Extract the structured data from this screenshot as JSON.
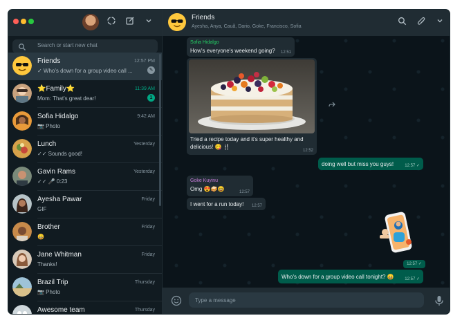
{
  "sidebar": {
    "search_placeholder": "Search or start new chat",
    "chats": [
      {
        "name": "Friends",
        "time": "12:57 PM",
        "last": "✓ Who's down for a group video call ...",
        "active": true,
        "time_green": false
      },
      {
        "name": "⭐Family⭐",
        "time": "11:39 AM",
        "last": "Mom: That's great dear!",
        "badge": "1",
        "time_green": true
      },
      {
        "name": "Sofia Hidalgo",
        "time": "9:42 AM",
        "last": "📷 Photo"
      },
      {
        "name": "Lunch",
        "time": "Yesterday",
        "last": "✓✓ Sounds good!"
      },
      {
        "name": "Gavin Rams",
        "time": "Yesterday",
        "last": "✓✓ 🎤 0:23"
      },
      {
        "name": "Ayesha Pawar",
        "time": "Friday",
        "last": "GIF"
      },
      {
        "name": "Brother",
        "time": "Friday",
        "last": "😄"
      },
      {
        "name": "Jane Whitman",
        "time": "Friday",
        "last": "Thanks!"
      },
      {
        "name": "Brazil Trip",
        "time": "Thursday",
        "last": "📷 Photo"
      },
      {
        "name": "Awesome team",
        "time": "Thursday",
        "last": ""
      }
    ]
  },
  "conversation": {
    "title": "Friends",
    "members": "Ayesha, Anya, Cauã, Dario, Goke, Francisco, Sofia",
    "messages": {
      "m1_sender": "Sofia Hidalgo",
      "m1_text": "How's everyone's weekend going?",
      "m1_time": "12:51",
      "m2_caption_1": "Tried a recipe today and it's super healthy and",
      "m2_caption_2": "delicious! 😋 🍴",
      "m2_time": "12:52",
      "m3_text": "doing well but miss you guys!",
      "m3_time": "12:57 ✓",
      "m4_sender": "Goke Kuyinu",
      "m4_text": "Omg 😍🥪😄",
      "m4_time": "12:57",
      "m5_text": "I went for a run today!",
      "m5_time": "12:57",
      "sticker_time": "12:57 ✓",
      "m6_text": "Who's down for a group video call tonight? 😄",
      "m6_time": "12:57 ✓"
    },
    "composer_placeholder": "Type a message"
  },
  "colors": {
    "accent": "#00a884",
    "outgoing": "#005c4b",
    "incoming": "#202c33",
    "sofia_name": "#25d366",
    "goke_name": "#c77dda"
  },
  "icons": [
    "search-icon",
    "new-status-icon",
    "new-chat-icon",
    "menu-chevron-icon",
    "attach-icon",
    "emoji-icon",
    "mic-icon",
    "forward-icon"
  ]
}
